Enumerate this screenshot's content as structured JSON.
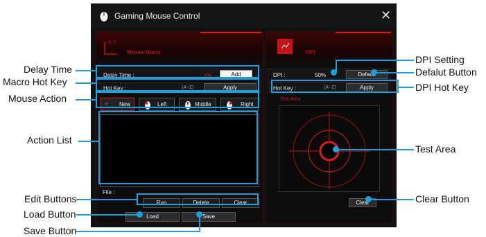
{
  "window": {
    "title": "Gaming Mouse Control",
    "close_icon": "close-icon"
  },
  "macro": {
    "header": "Mouse Macro",
    "xy_label": "X, Y",
    "delay_label": "Delay Time :",
    "delay_unit": "ms",
    "add_label": "Add",
    "hotkey_label": "Hot Key :",
    "hotkey_hint": "(A~Z)",
    "apply_label": "Apply",
    "actions": [
      {
        "label": "New",
        "icon": "cursor-icon"
      },
      {
        "label": "Left",
        "icon": "mouse-icon"
      },
      {
        "label": "Middle",
        "icon": "mouse-icon"
      },
      {
        "label": "Right",
        "icon": "mouse-icon"
      }
    ],
    "file_label": "File :",
    "run_label": "Run",
    "delete_label": "Delete",
    "clear_label": "Clear",
    "load_label": "Load",
    "save_label": "Save"
  },
  "dpi": {
    "header": "DPI",
    "dpi_label": "DPI :",
    "dpi_value": "50%",
    "default_label": "Default",
    "hotkey_label": "Hot Key :",
    "hotkey_hint": "(A~Z)",
    "apply_label": "Apply",
    "test_label": "Test Aera",
    "clear_label": "Clear"
  },
  "callouts": {
    "delay_time": "Delay Time",
    "macro_hot_key": "Macro Hot Key",
    "mouse_action": "Mouse Action",
    "action_list": "Action List",
    "edit_buttons": "Edit Buttons",
    "load_button": "Load Button",
    "save_button": "Save Button",
    "dpi_setting": "DPI Setting",
    "default_button": "Defalut Button",
    "dpi_hot_key": "DPI Hot Key",
    "test_area": "Test Area",
    "clear_button": "Clear Button"
  },
  "colors": {
    "accent": "#e01b1b",
    "callout": "#1aa0e0",
    "window_bg": "#111111"
  }
}
